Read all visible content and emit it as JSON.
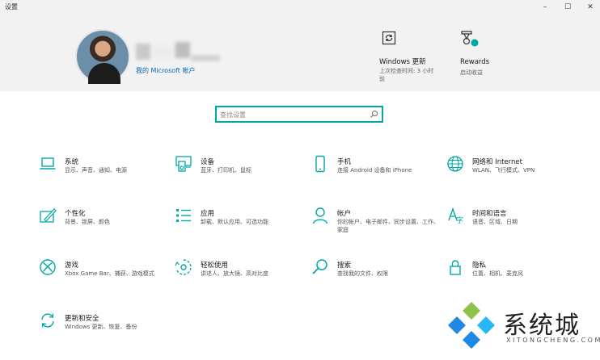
{
  "window": {
    "title": "设置",
    "minimize_glyph": "–",
    "maximize_glyph": "☐",
    "close_glyph": "✕"
  },
  "account": {
    "link": "我的 Microsoft 帐户"
  },
  "header_items": [
    {
      "name": "Windows 更新",
      "sub": [
        "上次检查时间: 3 小时",
        "前"
      ],
      "icon": "windows-update-icon"
    },
    {
      "name": "Rewards",
      "sub": [
        "启动收益"
      ],
      "icon": "rewards-icon"
    }
  ],
  "search": {
    "placeholder": "查找设置"
  },
  "tiles": [
    {
      "name": "系统",
      "desc": "显示、声音、通知、电源",
      "icon": "laptop-icon"
    },
    {
      "name": "设备",
      "desc": "蓝牙、打印机、鼠标",
      "icon": "devices-icon"
    },
    {
      "name": "手机",
      "desc": "连接 Android 设备和 iPhone",
      "icon": "phone-icon"
    },
    {
      "name": "网络和 Internet",
      "desc": "WLAN、飞行模式、VPN",
      "icon": "globe-icon"
    },
    {
      "name": "个性化",
      "desc": "背景、锁屏、颜色",
      "icon": "personalization-icon"
    },
    {
      "name": "应用",
      "desc": "卸载、默认应用、可选功能",
      "icon": "apps-list-icon"
    },
    {
      "name": "帐户",
      "desc": "你的帐户、电子邮件、同步设置、工作、家庭",
      "icon": "person-icon"
    },
    {
      "name": "时间和语言",
      "desc": "语音、区域、日期",
      "icon": "time-language-icon"
    },
    {
      "name": "游戏",
      "desc": "Xbox Game Bar、捕获、游戏模式",
      "icon": "xbox-icon"
    },
    {
      "name": "轻松使用",
      "desc": "讲述人、放大镜、高对比度",
      "icon": "ease-of-access-icon"
    },
    {
      "name": "搜索",
      "desc": "查找我的文件、权限",
      "icon": "search-icon"
    },
    {
      "name": "隐私",
      "desc": "位置、相机、麦克风",
      "icon": "lock-icon"
    },
    {
      "name": "更新和安全",
      "desc": "Windows 更新、恢复、备份",
      "icon": "sync-icon"
    }
  ],
  "watermark": {
    "text": "系统城",
    "sub": "XITONGCHENG.COM"
  },
  "colors": {
    "accent": "#00a8a8",
    "link": "#0067b8",
    "watermark_blue": "#1e88e5",
    "watermark_cyan": "#29b6f6"
  }
}
